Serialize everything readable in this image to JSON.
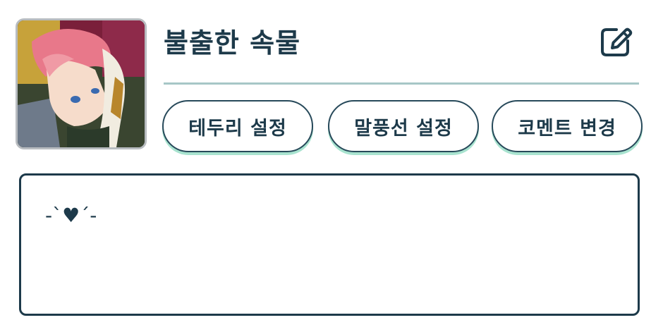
{
  "profile": {
    "name": "불출한 속물",
    "avatar_icon": "character-portrait"
  },
  "header": {
    "edit_icon": "pencil-square-icon"
  },
  "actions": [
    {
      "label": "테두리 설정"
    },
    {
      "label": "말풍선 설정"
    },
    {
      "label": "코멘트 변경"
    }
  ],
  "comment": {
    "text": "-`♥´-"
  },
  "colors": {
    "text": "#1d3a4a",
    "divider": "#a7c7c7",
    "button_shadow": "#a8e3cf",
    "avatar_border": "#b8bcc0"
  }
}
